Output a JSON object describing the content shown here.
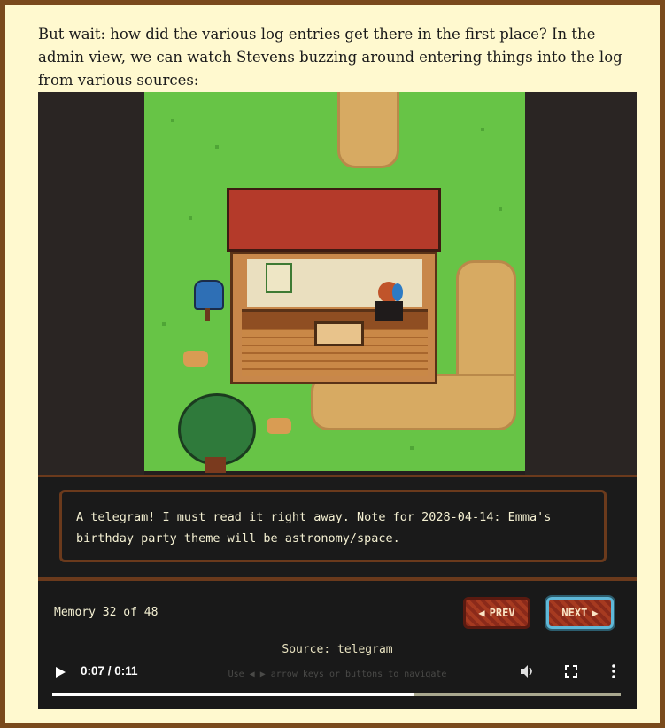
{
  "article": {
    "intro_text": "But wait: how did the various log entries get there in the first place? In the admin view, we can watch Stevens buzzing around entering things into the log from various sources:"
  },
  "game": {
    "dialog_text": "A telegram! I must read it right away. Note for 2028-04-14: Emma's birthday party theme will be astronomy/space.",
    "memory_counter": "Memory 32 of 48",
    "prev_label": "PREV",
    "next_label": "NEXT",
    "source_text": "Source: telegram",
    "hint_text": "Use ◀ ▶ arrow keys or buttons to navigate"
  },
  "player": {
    "time_display": "0:07 / 0:11",
    "progress_fraction": 0.636,
    "icons": [
      "play-icon",
      "volume-icon",
      "fullscreen-icon",
      "more-options-icon"
    ]
  },
  "colors": {
    "page_border": "#7a4a1c",
    "page_bg": "#fff9cf",
    "game_dark": "#1b1b1b",
    "button_red": "#a63a20",
    "next_button_outline": "#5fb8d8"
  }
}
